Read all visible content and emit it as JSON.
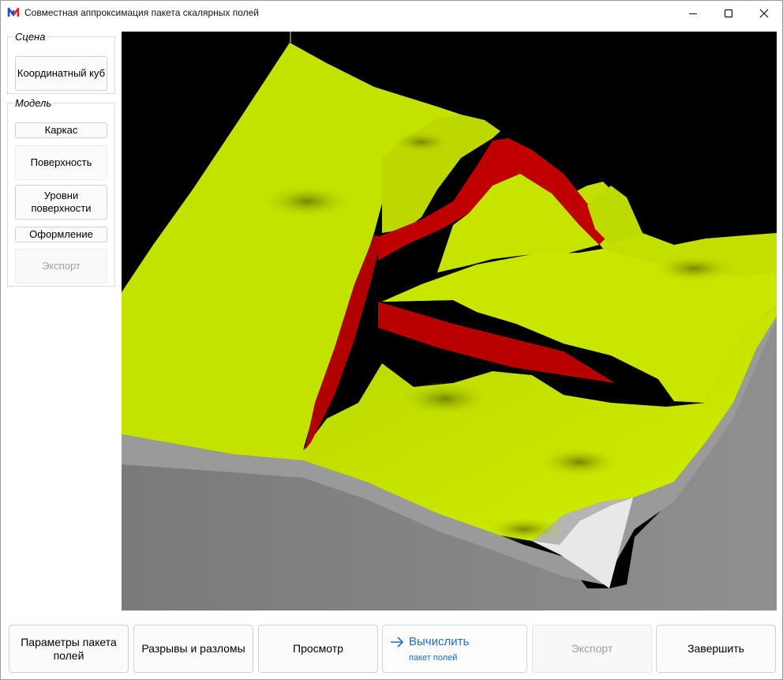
{
  "window": {
    "title": "Совместная аппроксимация пакета скалярных полей",
    "icon": "app-logo-icon",
    "controls": [
      "minimize-icon",
      "maximize-icon",
      "close-icon"
    ]
  },
  "left_panel": {
    "scene": {
      "legend": "Сцена",
      "buttons": {
        "coord_cube": "Координатный куб"
      }
    },
    "model": {
      "legend": "Модель",
      "buttons": {
        "frame": "Каркас",
        "surface": "Поверхность",
        "surface_levels": "Уровни поверхности",
        "design": "Оформление",
        "export": "Экспорт"
      }
    }
  },
  "viewport": {
    "background": "#000000",
    "surface_color": "#c8e600",
    "fault_color": "#c00000",
    "side_color": "#8a8a8a"
  },
  "bottom_bar": {
    "params": "Параметры пакета полей",
    "faults": "Разрывы и разломы",
    "view": "Просмотр",
    "compute": {
      "main": "Вычислить",
      "sub": "пакет полей"
    },
    "export": "Экспорт",
    "finish": "Завершить"
  }
}
